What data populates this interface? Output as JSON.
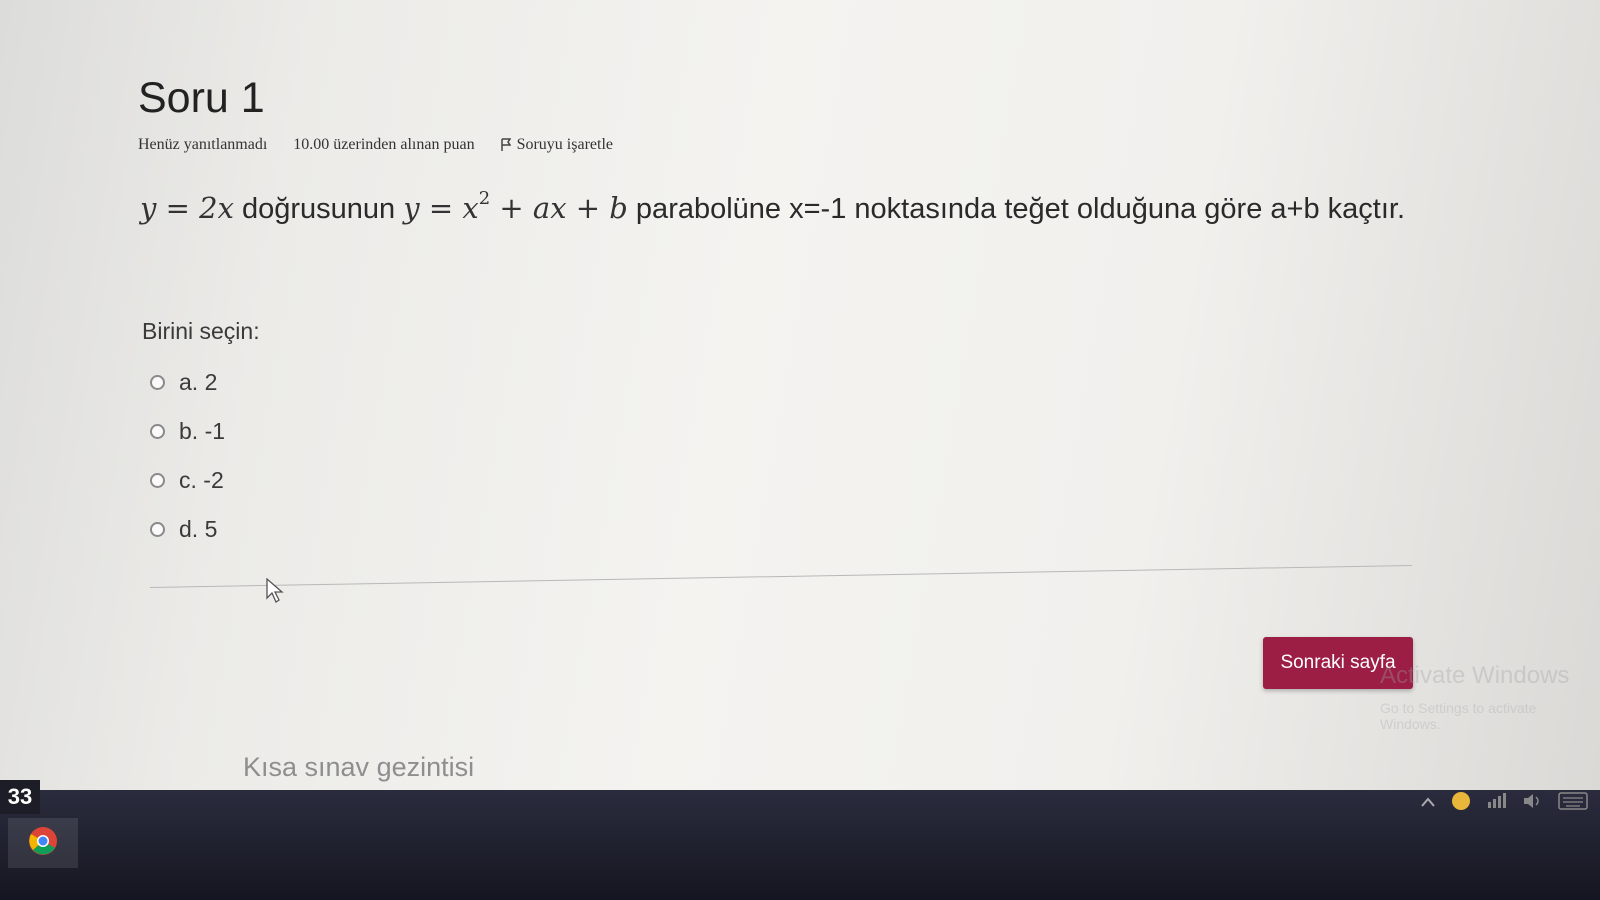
{
  "question": {
    "title": "Soru 1",
    "status": "Henüz yanıtlanmadı",
    "points": "10.00 üzerinden alınan puan",
    "flag_label": "Soruyu işaretle",
    "text": {
      "m1": "y = 2x",
      "t1": " doğrusunun ",
      "m2_base": "y = x",
      "m2_exp": "2",
      "m2_rest": " + ax + b",
      "t2": " parabolüne x=-1 noktasında teğet olduğuna göre a+b kaçtır."
    }
  },
  "answer": {
    "prompt": "Birini seçin:",
    "options": [
      {
        "label": "a. 2"
      },
      {
        "label": "b. -1"
      },
      {
        "label": "c. -2"
      },
      {
        "label": "d. 5"
      }
    ]
  },
  "navigation": {
    "next_label": "Sonraki sayfa",
    "quiz_nav_label": "Kısa sınav gezintisi"
  },
  "watermark": {
    "line1": "Activate Windows",
    "line2": "Go to Settings to activate Windows."
  },
  "taskbar": {
    "badge": "33",
    "colors": {
      "background": "#1e1f2c",
      "button": "#9c1e45"
    },
    "icons": [
      "chrome-icon",
      "chevron-up-icon",
      "notification-icon",
      "network-icon",
      "volume-icon",
      "keyboard-icon"
    ]
  }
}
